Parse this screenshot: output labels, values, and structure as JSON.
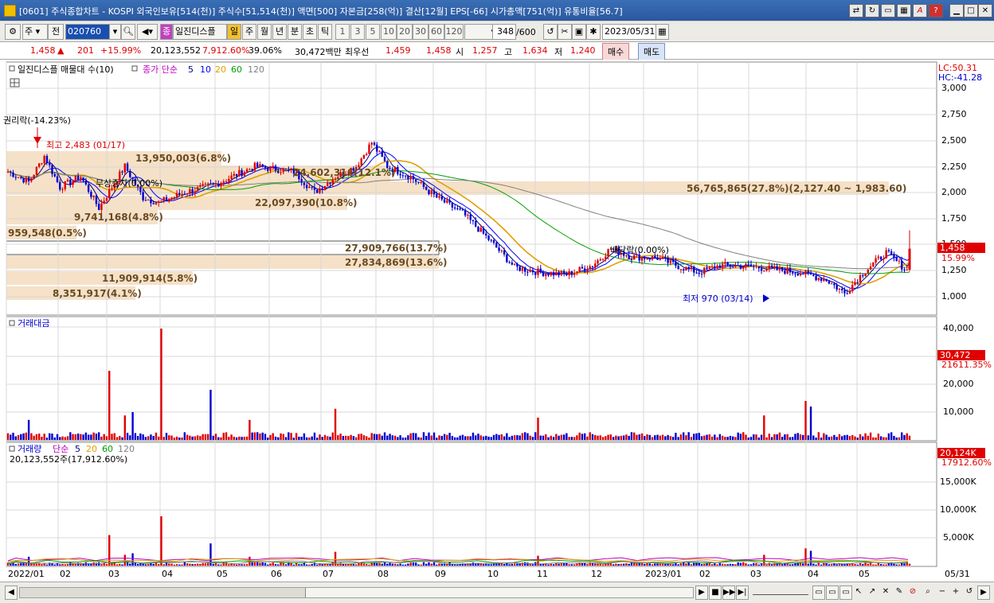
{
  "window": {
    "title": "[0601] 주식종합차트 - KOSPI 외국인보유[514(천)] 주식수[51,514(천)] 액면[500] 자본금[258(억)] 결산[12월] EPS[-66] 시가총액[751(억)] 유통비율[56.7]"
  },
  "toolbar": {
    "market": "주",
    "prev": "전",
    "code": "020760",
    "stock_name": "일진디스플",
    "period_active": "일",
    "periods": [
      "주",
      "월",
      "년",
      "분",
      "초",
      "틱"
    ],
    "minutes": [
      "1",
      "3",
      "5",
      "10",
      "20",
      "30",
      "60",
      "120"
    ],
    "count": "348",
    "count_total": "/600",
    "date": "2023/05/31"
  },
  "quote": {
    "price": "1,458",
    "change": "201",
    "change_pct": "+15.99%",
    "volume": "20,123,552",
    "vol_ratio": "7,912.60%",
    "turnover_pct": "39.06%",
    "amount": "30,472백만",
    "best_ask_label": "최우선",
    "best_ask": "1,459",
    "best_bid": "1,458",
    "open_label": "시",
    "open": "1,257",
    "high_label": "고",
    "high": "1,634",
    "low_label": "저",
    "low": "1,240",
    "buy_label": "매수",
    "sell_label": "매도"
  },
  "price_panel": {
    "title": "일진디스플 매물대 수(10)",
    "ma_label": "종가 단순",
    "ma_periods": [
      "5",
      "10",
      "20",
      "60",
      "120"
    ],
    "lc": "LC:50.31",
    "hc": "HC:-41.28",
    "current_price": "1,458",
    "current_pct": "15.99%",
    "yaxis": [
      "3,000",
      "2,750",
      "2,500",
      "2,250",
      "2,000",
      "1,750",
      "1,500",
      "1,250",
      "1,000"
    ],
    "annotations": {
      "rights": "권리락(-14.23%)",
      "high": "최고 2,483 (01/17)",
      "low": "최저 970 (03/14)",
      "dividend": "배당락(0.00%)",
      "bonus": "무상증자(0.00%)"
    },
    "volume_profile": [
      {
        "label": "959,548(0.5%)"
      },
      {
        "label": "9,741,168(4.8%)"
      },
      {
        "label": "13,950,003(6.8%)"
      },
      {
        "label": "22,097,390(10.8%)"
      },
      {
        "label": "24,602,316(12.1%)"
      },
      {
        "label": "56,765,865(27.8%)(2,127.40 ~ 1,983.60)"
      },
      {
        "label": "27,909,766(13.7%)"
      },
      {
        "label": "27,834,869(13.6%)"
      },
      {
        "label": "11,909,914(5.8%)"
      },
      {
        "label": "8,351,917(4.1%)"
      }
    ]
  },
  "amount_panel": {
    "title": "거래대금",
    "current": "30,472",
    "ratio": "21611.35%",
    "yaxis": [
      "40,000",
      "30,000",
      "20,000",
      "10,000"
    ]
  },
  "volume_panel": {
    "title": "거래량",
    "ma_label": "단순",
    "ma_periods": [
      "5",
      "20",
      "60",
      "120"
    ],
    "info": "20,123,552주(17,912.60%)",
    "current": "20,124K",
    "ratio": "17912.60%",
    "yaxis": [
      "15,000K",
      "10,000K",
      "5,000K"
    ]
  },
  "xaxis": [
    "2022/01",
    "02",
    "03",
    "04",
    "05",
    "06",
    "07",
    "08",
    "09",
    "10",
    "11",
    "12",
    "2023/01",
    "02",
    "03",
    "04",
    "05",
    "05/31"
  ],
  "colors": {
    "up": "#e00000",
    "down": "#0000d0",
    "ma5": "#000080",
    "ma10": "#0000ff",
    "ma20": "#e0a000",
    "ma60": "#00a000",
    "ma120": "#808080"
  }
}
